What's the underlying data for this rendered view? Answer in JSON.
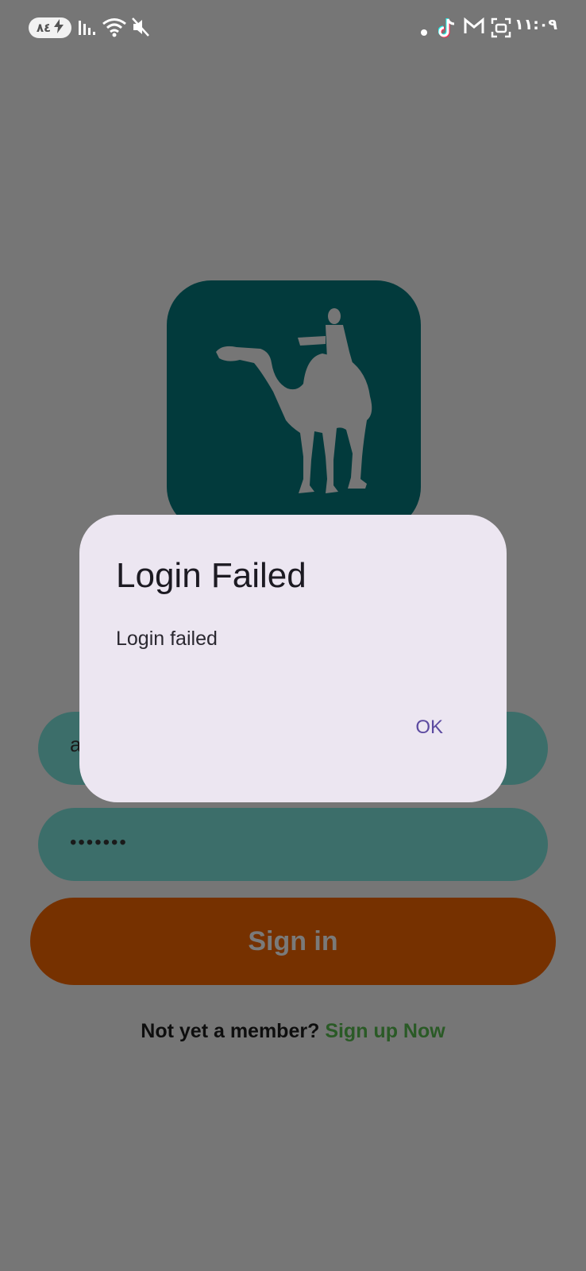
{
  "status_bar": {
    "battery_level": "٨٤",
    "time": "١١:٠٩",
    "icons": [
      "charging-icon",
      "signal-icon",
      "wifi-icon",
      "mute-icon",
      "dot-icon",
      "tiktok-icon",
      "gmail-icon",
      "screenshot-icon"
    ]
  },
  "login": {
    "username_value": "a",
    "password_value": "•••••••",
    "sign_in_label": "Sign in",
    "signup_prompt": "Not yet a member? ",
    "signup_link": "Sign up Now"
  },
  "dialog": {
    "title": "Login Failed",
    "message": "Login failed",
    "ok_label": "OK"
  },
  "colors": {
    "scrim": "#767676",
    "logo_bg": "#023a3c",
    "field_bg": "#3c6e6a",
    "button_bg": "#763100",
    "link": "#2a5a26",
    "dialog_bg": "#ece6f1",
    "dialog_action": "#5c4aa0"
  }
}
